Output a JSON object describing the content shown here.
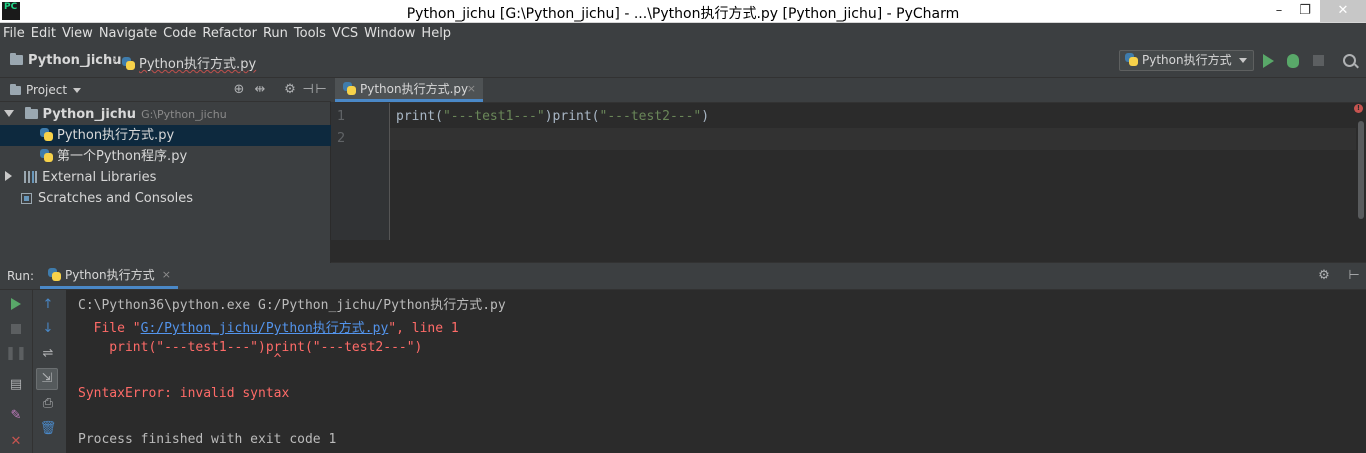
{
  "window": {
    "title": "Python_jichu [G:\\Python_jichu] - ...\\Python执行方式.py [Python_jichu] - PyCharm",
    "app_icon_text": "PC",
    "minimize": "–",
    "maximize": "❐",
    "close": "✕"
  },
  "menu": {
    "items": [
      "File",
      "Edit",
      "View",
      "Navigate",
      "Code",
      "Refactor",
      "Run",
      "Tools",
      "VCS",
      "Window",
      "Help"
    ]
  },
  "navbar": {
    "project": "Python_jichu",
    "file": "Python执行方式.py",
    "run_config": "Python执行方式"
  },
  "project_panel": {
    "title": "Project",
    "tree": {
      "root_name": "Python_jichu",
      "root_path": "G:\\Python_jichu",
      "files": [
        "Python执行方式.py",
        "第一个Python程序.py"
      ],
      "external_libraries": "External Libraries",
      "scratches": "Scratches and Consoles"
    }
  },
  "editor": {
    "tab_label": "Python执行方式.py",
    "tab_close": "×",
    "line_numbers": [
      "1",
      "2"
    ],
    "code": {
      "p1": "print(",
      "s1": "\"---test1---\"",
      "p2": ")print(",
      "s2": "\"---test2---\"",
      "p3": ")"
    },
    "error_marker": "!"
  },
  "run_panel": {
    "label": "Run:",
    "tab_label": "Python执行方式",
    "tab_close": "×",
    "console": {
      "command": "C:\\Python36\\python.exe G:/Python_jichu/Python执行方式.py",
      "file_prefix": "  File \"",
      "file_link": "G:/Python_jichu/Python执行方式.py",
      "file_suffix": "\", line 1",
      "code_line": "    print(\"---test1---\")print(\"---test2---\")",
      "caret_line": "                         ^",
      "error": "SyntaxError: invalid syntax",
      "exit": "Process finished with exit code 1"
    }
  },
  "colors": {
    "accent": "#4a88c7",
    "run_green": "#59a869",
    "error_red": "#ff6b68",
    "link_blue": "#5394ec"
  }
}
